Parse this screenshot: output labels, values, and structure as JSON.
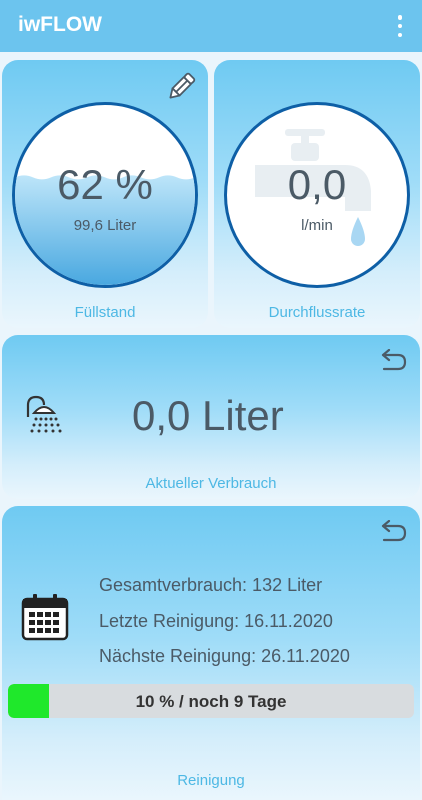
{
  "app": {
    "title": "iwFLOW"
  },
  "fill_level": {
    "percent_label": "62 %",
    "percent": 62,
    "volume": "99,6 Liter",
    "label": "Füllstand"
  },
  "flow_rate": {
    "value": "0,0",
    "unit": "l/min",
    "label": "Durchflussrate"
  },
  "usage": {
    "value": "0,0 Liter",
    "label": "Aktueller Verbrauch"
  },
  "cleaning": {
    "total": "Gesamtverbrauch: 132 Liter",
    "last": "Letzte Reinigung: 16.11.2020",
    "next": "Nächste Reinigung: 26.11.2020",
    "progress_text": "10 % / noch 9 Tage",
    "progress_fraction": 0.1,
    "label": "Reinigung"
  },
  "colors": {
    "appbar": "#6cc4ee",
    "accent": "#4db8e4",
    "ring": "#0e5fa6",
    "progress_fill": "#1fe82b"
  },
  "icons": [
    "more-vert-icon",
    "pencil-icon",
    "faucet-icon",
    "water-drop-icon",
    "undo-icon",
    "shower-icon",
    "calendar-icon"
  ]
}
